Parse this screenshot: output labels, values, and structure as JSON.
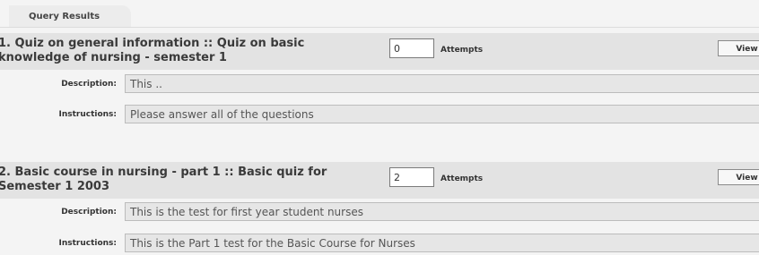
{
  "tab": {
    "label": "Query Results"
  },
  "results": [
    {
      "title": "1. Quiz on general information :: Quiz on basic knowledge of nursing - semester 1",
      "attempts_value": "0",
      "attempts_label": "Attempts",
      "view_label": "View",
      "description_label": "Description:",
      "description": "This ..",
      "instructions_label": "Instructions:",
      "instructions": "Please answer all of the questions"
    },
    {
      "title": "2. Basic course in nursing - part 1 :: Basic quiz for Semester 1 2003",
      "attempts_value": "2",
      "attempts_label": "Attempts",
      "view_label": "View",
      "description_label": "Description:",
      "description": "This is the test for first year student nurses",
      "instructions_label": "Instructions:",
      "instructions": "This is the Part 1 test for the Basic Course for Nurses"
    }
  ]
}
